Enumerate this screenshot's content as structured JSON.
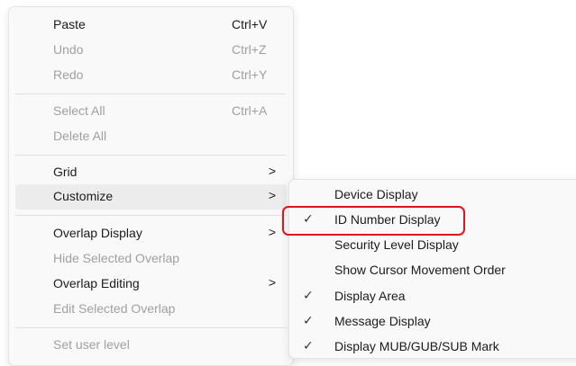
{
  "main_menu": {
    "items": [
      {
        "label": "Paste",
        "shortcut": "Ctrl+V",
        "disabled": false
      },
      {
        "label": "Undo",
        "shortcut": "Ctrl+Z",
        "disabled": true
      },
      {
        "label": "Redo",
        "shortcut": "Ctrl+Y",
        "disabled": true
      },
      {
        "label": "Select All",
        "shortcut": "Ctrl+A",
        "disabled": true
      },
      {
        "label": "Delete All",
        "shortcut": "",
        "disabled": true
      },
      {
        "label": "Grid",
        "arrow": ">",
        "disabled": false
      },
      {
        "label": "Customize",
        "arrow": ">",
        "disabled": false
      },
      {
        "label": "Overlap Display",
        "arrow": ">",
        "disabled": false
      },
      {
        "label": "Hide Selected Overlap",
        "disabled": true
      },
      {
        "label": "Overlap Editing",
        "arrow": ">",
        "disabled": false
      },
      {
        "label": "Edit Selected Overlap",
        "disabled": true
      },
      {
        "label": "Set user level",
        "disabled": true
      }
    ]
  },
  "sub_menu": {
    "items": [
      {
        "label": "Device Display",
        "checked": false,
        "check": ""
      },
      {
        "label": "ID Number Display",
        "checked": true,
        "check": "✓"
      },
      {
        "label": "Security Level Display",
        "checked": false,
        "check": ""
      },
      {
        "label": "Show Cursor Movement Order",
        "checked": false,
        "check": ""
      },
      {
        "label": "Display Area",
        "checked": true,
        "check": "✓"
      },
      {
        "label": "Message Display",
        "checked": true,
        "check": "✓"
      },
      {
        "label": "Display MUB/GUB/SUB Mark",
        "checked": true,
        "check": "✓"
      }
    ]
  },
  "highlight": {
    "target": "ID Number Display",
    "color": "#e0141e"
  }
}
